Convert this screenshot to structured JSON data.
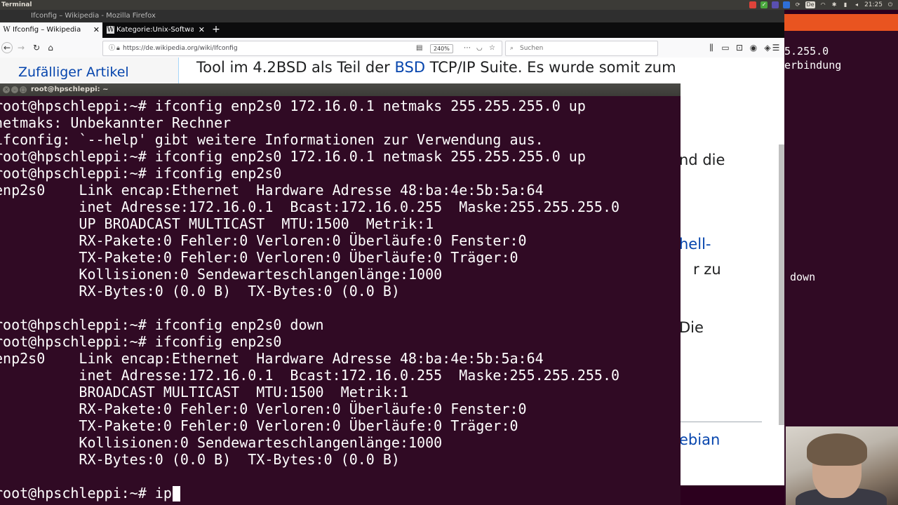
{
  "top_panel": {
    "app_name": "Terminal",
    "clock": "21:25",
    "tray_icons": [
      "record-icon",
      "check-icon",
      "sync-icon",
      "dropbox-icon",
      "bluetooth-icon",
      "keyboard-layout-icon",
      "wifi-icon",
      "bluetooth-icon",
      "battery-icon",
      "volume-icon",
      "power-icon"
    ],
    "keyboard_layout": "De"
  },
  "firefox": {
    "window_title": "Ifconfig – Wikipedia - Mozilla Firefox",
    "tabs": [
      {
        "label": "Ifconfig – Wikipedia",
        "favicon": "W",
        "active": true
      },
      {
        "label": "Kategorie:Unix-Softwar",
        "favicon": "W",
        "active": false
      }
    ],
    "url": "https://de.wikipedia.org/wiki/Ifconfig",
    "zoom": "240%",
    "search_placeholder": "Suchen",
    "sidebar_link": "Zufälliger Artikel",
    "body": {
      "line1_before": "Tool im 4.2BSD als Teil der ",
      "line1_link": "BSD",
      "line1_after": " TCP/IP Suite. Es wurde somit zum",
      "frag1": "nd die",
      "frag2": "hell-",
      "frag3": "r zu",
      "frag4": "Die",
      "frag5": "ebian"
    }
  },
  "background_terminal": {
    "line1": "5.255.0",
    "line2": "erbindung",
    "line3": "down"
  },
  "terminal": {
    "title": "root@hpschleppi: ~",
    "lines": [
      "root@hpschleppi:~# ifconfig enp2s0 172.16.0.1 netmaks 255.255.255.0 up",
      "netmaks: Unbekannter Rechner",
      "ifconfig: `--help' gibt weitere Informationen zur Verwendung aus.",
      "root@hpschleppi:~# ifconfig enp2s0 172.16.0.1 netmask 255.255.255.0 up",
      "root@hpschleppi:~# ifconfig enp2s0",
      "enp2s0    Link encap:Ethernet  Hardware Adresse 48:ba:4e:5b:5a:64",
      "          inet Adresse:172.16.0.1  Bcast:172.16.0.255  Maske:255.255.255.0",
      "          UP BROADCAST MULTICAST  MTU:1500  Metrik:1",
      "          RX-Pakete:0 Fehler:0 Verloren:0 Überläufe:0 Fenster:0",
      "          TX-Pakete:0 Fehler:0 Verloren:0 Überläufe:0 Träger:0",
      "          Kollisionen:0 Sendewarteschlangenlänge:1000",
      "          RX-Bytes:0 (0.0 B)  TX-Bytes:0 (0.0 B)",
      "",
      "root@hpschleppi:~# ifconfig enp2s0 down",
      "root@hpschleppi:~# ifconfig enp2s0",
      "enp2s0    Link encap:Ethernet  Hardware Adresse 48:ba:4e:5b:5a:64",
      "          inet Adresse:172.16.0.1  Bcast:172.16.0.255  Maske:255.255.255.0",
      "          BROADCAST MULTICAST  MTU:1500  Metrik:1",
      "          RX-Pakete:0 Fehler:0 Verloren:0 Überläufe:0 Fenster:0",
      "          TX-Pakete:0 Fehler:0 Verloren:0 Überläufe:0 Träger:0",
      "          Kollisionen:0 Sendewarteschlangenlänge:1000",
      "          RX-Bytes:0 (0.0 B)  TX-Bytes:0 (0.0 B)",
      ""
    ],
    "prompt": "root@hpschleppi:~# ",
    "current_input": "ip"
  },
  "colors": {
    "terminal_bg": "#300a24",
    "terminal_fg": "#ffffff",
    "ubuntu_orange": "#e95420",
    "wiki_link": "#0645ad"
  }
}
